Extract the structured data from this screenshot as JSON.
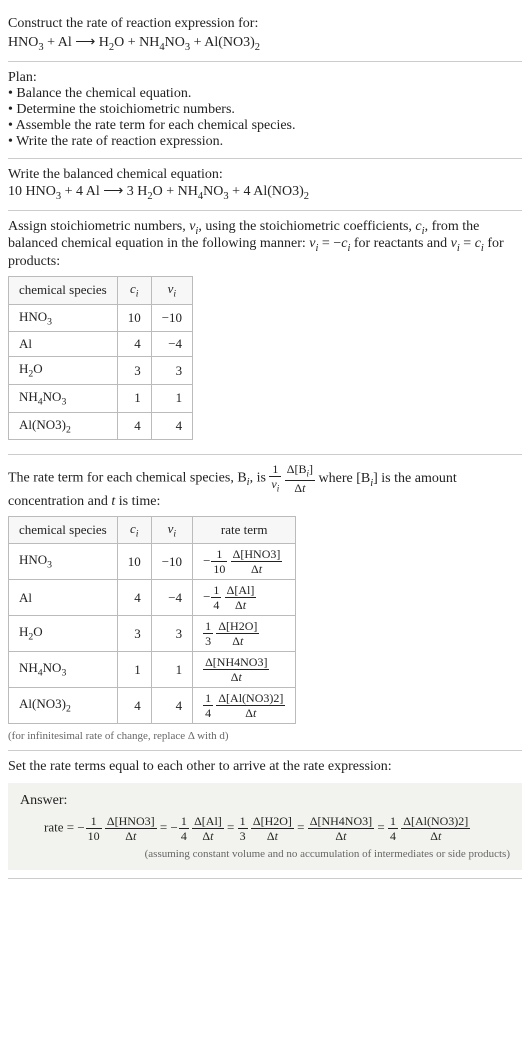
{
  "intro": {
    "prompt": "Construct the rate of reaction expression for:",
    "equation_html": "HNO<sub>3</sub> + Al ⟶ H<sub>2</sub>O + NH<sub>4</sub>NO<sub>3</sub> + Al(NO3)<sub>2</sub>"
  },
  "plan": {
    "heading": "Plan:",
    "items": [
      "• Balance the chemical equation.",
      "• Determine the stoichiometric numbers.",
      "• Assemble the rate term for each chemical species.",
      "• Write the rate of reaction expression."
    ]
  },
  "balanced": {
    "heading": "Write the balanced chemical equation:",
    "equation_html": "10 HNO<sub>3</sub> + 4 Al ⟶ 3 H<sub>2</sub>O + NH<sub>4</sub>NO<sub>3</sub> + 4 Al(NO3)<sub>2</sub>"
  },
  "stoich": {
    "intro_html": "Assign stoichiometric numbers, <i>ν<sub>i</sub></i>, using the stoichiometric coefficients, <i>c<sub>i</sub></i>, from the balanced chemical equation in the following manner: <i>ν<sub>i</sub></i> = −<i>c<sub>i</sub></i> for reactants and <i>ν<sub>i</sub></i> = <i>c<sub>i</sub></i> for products:",
    "headers": [
      "chemical species",
      "c_i",
      "ν_i"
    ],
    "rows": [
      {
        "species_html": "HNO<sub>3</sub>",
        "c": "10",
        "v": "−10"
      },
      {
        "species_html": "Al",
        "c": "4",
        "v": "−4"
      },
      {
        "species_html": "H<sub>2</sub>O",
        "c": "3",
        "v": "3"
      },
      {
        "species_html": "NH<sub>4</sub>NO<sub>3</sub>",
        "c": "1",
        "v": "1"
      },
      {
        "species_html": "Al(NO3)<sub>2</sub>",
        "c": "4",
        "v": "4"
      }
    ]
  },
  "rateterm": {
    "intro_pre": "The rate term for each chemical species, B",
    "intro_mid": ", is ",
    "intro_post_html": " where [B<sub><i>i</i></sub>] is the amount concentration and <i>t</i> is time:",
    "headers": [
      "chemical species",
      "c_i",
      "ν_i",
      "rate term"
    ],
    "rows": [
      {
        "species_html": "HNO<sub>3</sub>",
        "c": "10",
        "v": "−10",
        "neg": true,
        "coef_num": "1",
        "coef_den": "10",
        "dnum_html": "Δ[HNO3]",
        "dden_html": "Δ<i>t</i>"
      },
      {
        "species_html": "Al",
        "c": "4",
        "v": "−4",
        "neg": true,
        "coef_num": "1",
        "coef_den": "4",
        "dnum_html": "Δ[Al]",
        "dden_html": "Δ<i>t</i>"
      },
      {
        "species_html": "H<sub>2</sub>O",
        "c": "3",
        "v": "3",
        "neg": false,
        "coef_num": "1",
        "coef_den": "3",
        "dnum_html": "Δ[H2O]",
        "dden_html": "Δ<i>t</i>"
      },
      {
        "species_html": "NH<sub>4</sub>NO<sub>3</sub>",
        "c": "1",
        "v": "1",
        "neg": false,
        "coef_num": null,
        "coef_den": null,
        "dnum_html": "Δ[NH4NO3]",
        "dden_html": "Δ<i>t</i>"
      },
      {
        "species_html": "Al(NO3)<sub>2</sub>",
        "c": "4",
        "v": "4",
        "neg": false,
        "coef_num": "1",
        "coef_den": "4",
        "dnum_html": "Δ[Al(NO3)2]",
        "dden_html": "Δ<i>t</i>"
      }
    ],
    "note": "(for infinitesimal rate of change, replace Δ with d)"
  },
  "final": {
    "heading": "Set the rate terms equal to each other to arrive at the rate expression:",
    "answer_label": "Answer:",
    "rate_label": "rate = ",
    "terms": [
      {
        "neg": true,
        "coef_num": "1",
        "coef_den": "10",
        "dnum_html": "Δ[HNO3]",
        "dden_html": "Δ<i>t</i>"
      },
      {
        "neg": true,
        "coef_num": "1",
        "coef_den": "4",
        "dnum_html": "Δ[Al]",
        "dden_html": "Δ<i>t</i>"
      },
      {
        "neg": false,
        "coef_num": "1",
        "coef_den": "3",
        "dnum_html": "Δ[H2O]",
        "dden_html": "Δ<i>t</i>"
      },
      {
        "neg": false,
        "coef_num": null,
        "coef_den": null,
        "dnum_html": "Δ[NH4NO3]",
        "dden_html": "Δ<i>t</i>"
      },
      {
        "neg": false,
        "coef_num": "1",
        "coef_den": "4",
        "dnum_html": "Δ[Al(NO3)2]",
        "dden_html": "Δ<i>t</i>"
      }
    ],
    "assumption": "(assuming constant volume and no accumulation of intermediates or side products)"
  }
}
